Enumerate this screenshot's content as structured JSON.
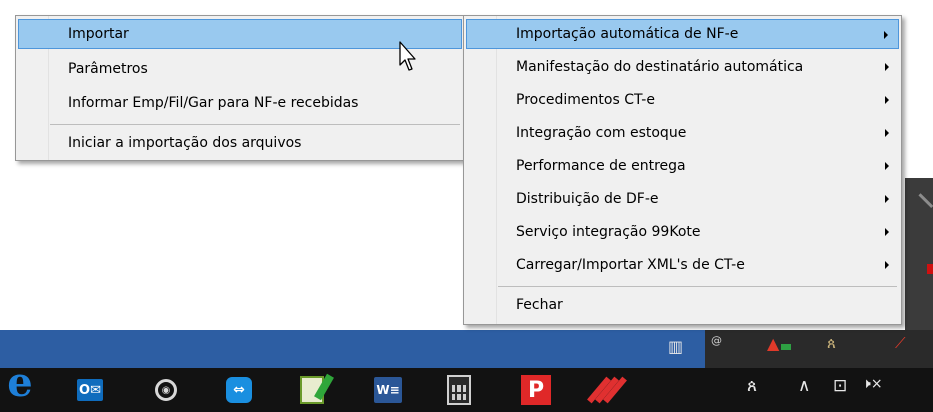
{
  "submenu": {
    "items": [
      {
        "label": "Importar",
        "highlighted": true
      },
      {
        "label": "Parâmetros"
      },
      {
        "label": "Informar Emp/Fil/Gar para NF-e recebidas"
      },
      {
        "label": "Iniciar a importação dos arquivos"
      }
    ]
  },
  "main_menu": {
    "items": [
      {
        "label": "Importação automática de NF-e",
        "highlighted": true,
        "has_submenu": true
      },
      {
        "label": "Manifestação do destinatário automática",
        "has_submenu": true
      },
      {
        "label": "Procedimentos CT-e",
        "has_submenu": true
      },
      {
        "label": "Integração com estoque",
        "has_submenu": true
      },
      {
        "label": "Performance de entrega",
        "has_submenu": true
      },
      {
        "label": "Distribuição de DF-e",
        "has_submenu": true
      },
      {
        "label": "Serviço integração 99Kote",
        "has_submenu": true
      },
      {
        "label": "Carregar/Importar XML's de CT-e",
        "has_submenu": true
      },
      {
        "label": "Fechar",
        "has_submenu": false
      }
    ]
  },
  "taskbar": {
    "outlook_label": "O",
    "word_label": "W",
    "p_label": "P",
    "edge_label": "e",
    "people_label": "ጰ",
    "chevron_label": "∧",
    "network_label": "⊡",
    "volume_label": "🕨×"
  },
  "colors": {
    "menu_bg": "#f0f0f0",
    "highlight_bg": "#99c9ef",
    "highlight_border": "#4e96db",
    "taskbar_bg": "#121212",
    "strip_bg": "#2d5ea3"
  }
}
